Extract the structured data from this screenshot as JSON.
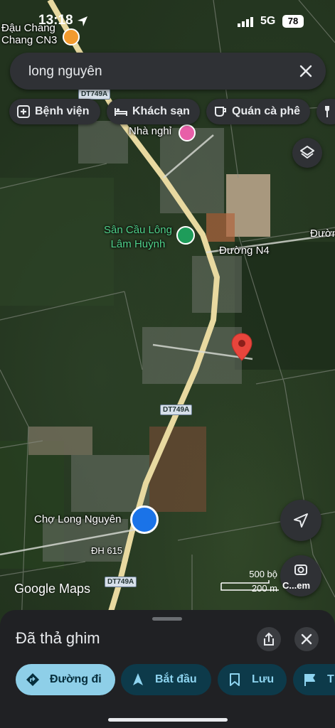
{
  "status_bar": {
    "time": "13:18",
    "network": "5G",
    "battery": "78"
  },
  "search": {
    "query": "long nguyên"
  },
  "chips": [
    {
      "label": "Bệnh viện",
      "icon": "hospital-icon"
    },
    {
      "label": "Khách sạn",
      "icon": "bed-icon"
    },
    {
      "label": "Quán cà phê",
      "icon": "coffee-icon"
    }
  ],
  "map": {
    "labels": {
      "dau_chang_line1": "Đậu Chang",
      "dau_chang_line2": "Chang CN3",
      "nha_nghi": "Nhà nghỉ",
      "san_cau_long_line1": "Sân Cầu Lông",
      "san_cau_long_line2": "Lâm Huỳnh",
      "duong_n4": "Đường N4",
      "duong_edge": "Đườn",
      "cho_long_nguyen": "Chợ Long Nguyên",
      "dh615": "ĐH 615"
    },
    "shields": {
      "top": "DT749A",
      "middle": "DT749A",
      "bottom": "DT749A"
    },
    "brand": "Google Maps",
    "scale": {
      "imperial": "500 bộ",
      "metric": "200 m"
    },
    "streetview_label": "C...em"
  },
  "sheet": {
    "title": "Đã thả ghim",
    "actions": [
      {
        "label": "Đường đi",
        "icon": "directions-icon",
        "primary": true
      },
      {
        "label": "Bắt đầu",
        "icon": "navigate-arrow-icon",
        "primary": false
      },
      {
        "label": "Lưu",
        "icon": "bookmark-icon",
        "primary": false
      },
      {
        "label": "T",
        "icon": "flag-icon",
        "primary": false
      }
    ]
  },
  "colors": {
    "pin": "#e8453c",
    "road": "#e8d9a0",
    "chip_bg": "#2f3135",
    "primary_button": "#8ecfe8",
    "poi_green": "#4fd08a"
  }
}
